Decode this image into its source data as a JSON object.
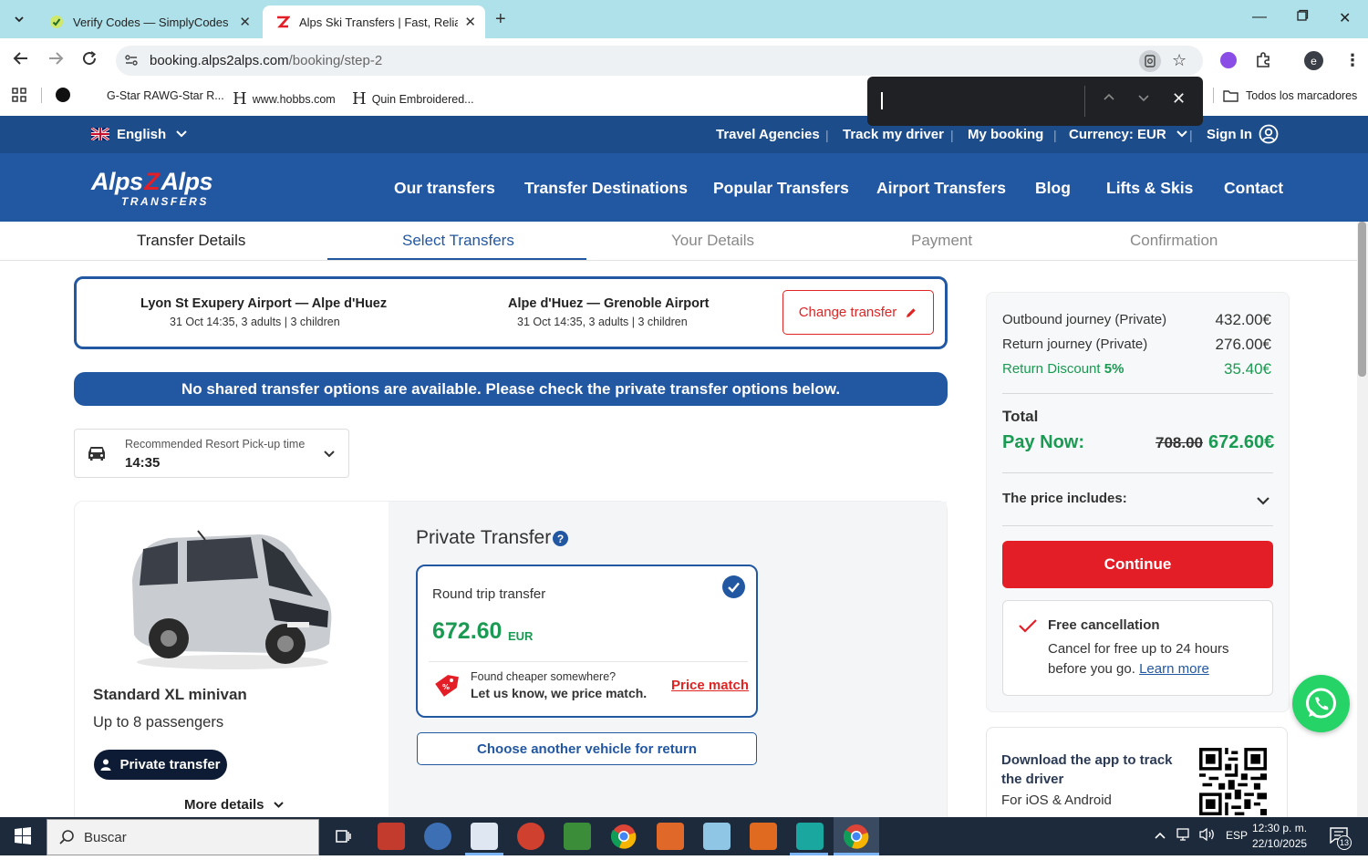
{
  "browser": {
    "tabs": [
      {
        "title": "Verify Codes — SimplyCodes",
        "active": false
      },
      {
        "title": "Alps Ski Transfers | Fast, Reliable",
        "active": true
      }
    ],
    "url_host": "booking.alps2alps.com",
    "url_path": "/booking/step-2",
    "bookmarks": [
      "G-Star RAWG-Star R...",
      "www.hobbs.com",
      "Quin Embroidered..."
    ],
    "bookmarks_all": "Todos los marcadores",
    "profile_initial": "e"
  },
  "site": {
    "language": "English",
    "top_links": [
      "Travel Agencies",
      "Track my driver",
      "My booking"
    ],
    "currency_label": "Currency:",
    "currency": "EUR",
    "sign_in": "Sign In",
    "logo_word1": "Alps",
    "logo_word2": "Alps",
    "logo_tag": "TRANSFERS",
    "nav": [
      "Our transfers",
      "Transfer Destinations",
      "Popular Transfers",
      "Airport Transfers",
      "Blog",
      "Lifts & Skis",
      "Contact"
    ]
  },
  "steps": [
    "Transfer Details",
    "Select Transfers",
    "Your Details",
    "Payment",
    "Confirmation"
  ],
  "route": {
    "outbound_title": "Lyon St Exupery Airport — Alpe d'Huez",
    "outbound_sub": "31 Oct 14:35, 3 adults | 3 children",
    "return_title": "Alpe d'Huez — Grenoble Airport",
    "return_sub": "31 Oct 14:35, 3 adults | 3 children",
    "change_label": "Change transfer"
  },
  "banner": "No shared transfer options are available. Please check the private transfer options below.",
  "pickup": {
    "label": "Recommended Resort Pick-up time",
    "value": "14:35"
  },
  "vehicle": {
    "name": "Standard XL minivan",
    "passengers": "Up to 8 passengers",
    "badge": "Private transfer",
    "more": "More details",
    "section_title": "Private Transfer",
    "option_name": "Round trip transfer",
    "option_price": "672.60",
    "option_currency": "EUR",
    "pm_line1": "Found cheaper somewhere?",
    "pm_line2": "Let us know, we price match.",
    "pm_link": "Price match",
    "choose_other": "Choose another vehicle for return"
  },
  "summary": {
    "outbound_label": "Outbound journey (Private)",
    "outbound_value": "432.00€",
    "return_label": "Return journey (Private)",
    "return_value": "276.00€",
    "discount_label": "Return Discount",
    "discount_pct": "5%",
    "discount_value": "35.40€",
    "total_label": "Total",
    "paynow_label": "Pay Now:",
    "old_price": "708.00",
    "new_price": "672.60€",
    "includes_label": "The price includes:",
    "continue_label": "Continue",
    "free_title": "Free cancellation",
    "free_text": "Cancel for free up to 24 hours before you go.",
    "learn_more": "Learn more",
    "app_title": "Download the app to track the driver",
    "app_sub": "For iOS & Android"
  },
  "taskbar": {
    "search_placeholder": "Buscar",
    "lang": "ESP",
    "time": "12:30 p. m.",
    "date": "22/10/2025",
    "notif_count": "13"
  },
  "colors": {
    "brand_blue": "#2257a2",
    "dark_blue": "#1c4d8a",
    "red": "#e41e26",
    "green": "#1a9a52",
    "tabstrip": "#aee1ea"
  }
}
